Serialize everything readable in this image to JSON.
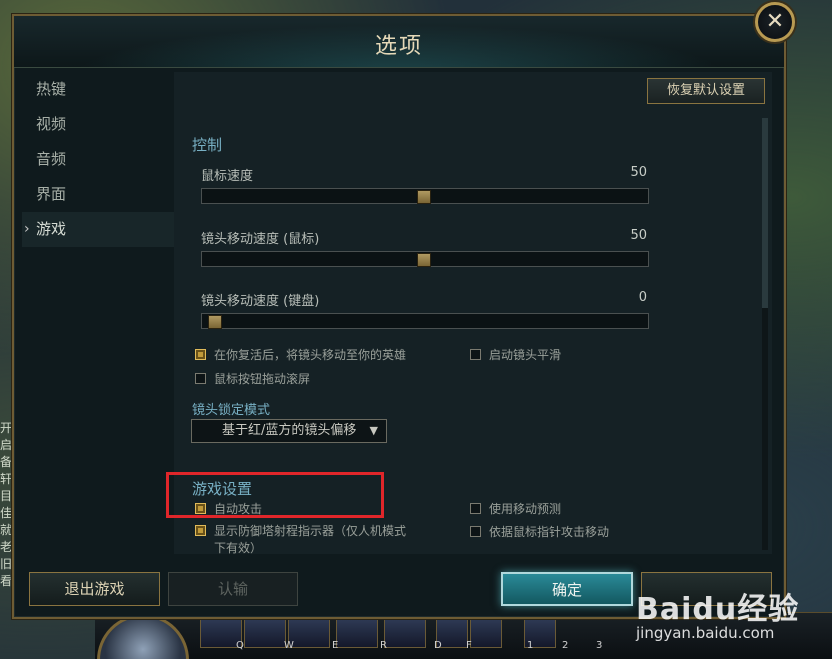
{
  "dialog": {
    "title": "选项",
    "close_glyph": "✕"
  },
  "sidebar": {
    "items": [
      {
        "label": "热键",
        "active": false
      },
      {
        "label": "视频",
        "active": false
      },
      {
        "label": "音频",
        "active": false
      },
      {
        "label": "界面",
        "active": false
      },
      {
        "label": "游戏",
        "active": true
      }
    ]
  },
  "panel": {
    "reset_label": "恢复默认设置",
    "control": {
      "title": "控制",
      "sliders": [
        {
          "label": "鼠标速度",
          "value": "50",
          "fraction": 0.5
        },
        {
          "label": "镜头移动速度 (鼠标)",
          "value": "50",
          "fraction": 0.5
        },
        {
          "label": "镜头移动速度 (键盘)",
          "value": "0",
          "fraction": 0.0
        }
      ],
      "checkboxes": [
        {
          "label": "在你复活后，将镜头移动至你的英雄",
          "checked": true
        },
        {
          "label": "启动镜头平滑",
          "checked": false
        },
        {
          "label": "鼠标按钮拖动滚屏",
          "checked": false
        }
      ],
      "lock_mode_label": "镜头锁定模式",
      "lock_mode_value": "基于红/蓝方的镜头偏移",
      "dropdown_arrow": "▼"
    },
    "game_settings": {
      "title": "游戏设置",
      "checkboxes": [
        {
          "label": "自动攻击",
          "checked": true
        },
        {
          "label": "使用移动预测",
          "checked": false
        },
        {
          "label": "显示防御塔射程指示器（仅人机模式",
          "label2": "下有效）",
          "checked": true
        },
        {
          "label": "依据鼠标指针攻击移动",
          "checked": false
        }
      ]
    }
  },
  "footer": {
    "exit_label": "退出游戏",
    "surrender_label": "认输",
    "ok_label": "确定"
  },
  "background": {
    "side_text": [
      "开启",
      "备轩",
      "目：",
      "",
      "佳就",
      "老旧",
      "看"
    ],
    "hud_keys": [
      "Q",
      "W",
      "E",
      "R",
      "D",
      "F",
      "1",
      "2",
      "3"
    ]
  },
  "watermark": {
    "logo": "Baidu经验",
    "sub": "jingyan.baidu.com"
  },
  "colors": {
    "accent_gold": "#8a7440",
    "section_blue": "#78b0c4",
    "highlight_red": "#e0262a",
    "primary_teal": "#2a8a98"
  }
}
